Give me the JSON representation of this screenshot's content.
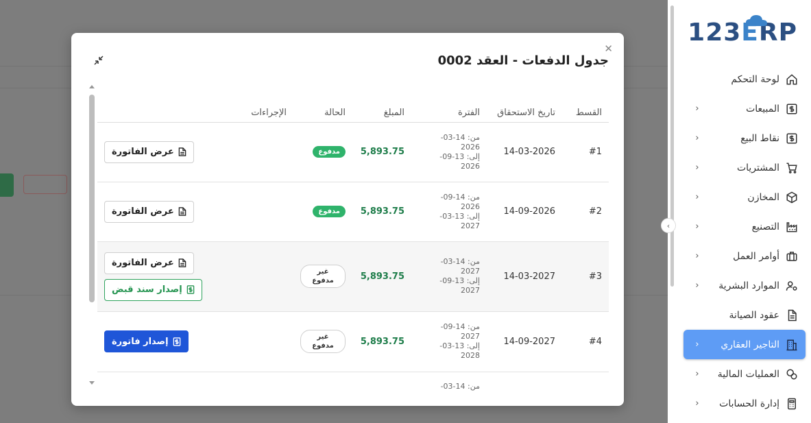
{
  "sidebar": {
    "logo": "123ERP",
    "items": [
      {
        "label": "لوحة التحكم",
        "icon": "home-icon",
        "has_children": false,
        "active": false
      },
      {
        "label": "المبيعات",
        "icon": "dollar-icon",
        "has_children": true,
        "active": false
      },
      {
        "label": "نقاط البيع",
        "icon": "dollar-icon",
        "has_children": true,
        "active": false
      },
      {
        "label": "المشتريات",
        "icon": "cart-icon",
        "has_children": true,
        "active": false
      },
      {
        "label": "المخازن",
        "icon": "box-icon",
        "has_children": true,
        "active": false
      },
      {
        "label": "التصنيع",
        "icon": "factory-icon",
        "has_children": true,
        "active": false
      },
      {
        "label": "أوامر العمل",
        "icon": "briefcase-icon",
        "has_children": true,
        "active": false
      },
      {
        "label": "الموارد البشرية",
        "icon": "user-gear-icon",
        "has_children": true,
        "active": false
      },
      {
        "label": "عقود الصيانة",
        "icon": "document-icon",
        "has_children": false,
        "active": false
      },
      {
        "label": "التاجير العقاري",
        "icon": "building-icon",
        "has_children": true,
        "active": true
      },
      {
        "label": "العمليات المالية",
        "icon": "coins-icon",
        "has_children": true,
        "active": false
      },
      {
        "label": "إدارة الحسابات",
        "icon": "calculator-icon",
        "has_children": true,
        "active": false
      }
    ]
  },
  "modal": {
    "title": "جدول الدفعات - العقد 0002",
    "columns": {
      "installment": "القسط",
      "due_date": "تاريخ الاستحقاق",
      "period": "الفترة",
      "amount": "المبلغ",
      "status": "الحالة",
      "actions": "الإجراءات"
    },
    "rows": [
      {
        "installment": "#1",
        "due_date": "14-03-2026",
        "period_from": "من: 14-03-2026",
        "period_to": "إلى: 13-09-2026",
        "amount": "5,893.75",
        "status": "مدفوع",
        "view_invoice": "عرض الفاتورة"
      },
      {
        "installment": "#2",
        "due_date": "14-09-2026",
        "period_from": "من: 14-09-2026",
        "period_to": "إلى: 13-03-2027",
        "amount": "5,893.75",
        "status": "مدفوع",
        "view_invoice": "عرض الفاتورة"
      },
      {
        "installment": "#3",
        "due_date": "14-03-2027",
        "period_from": "من: 14-03-2027",
        "period_to": "إلى: 13-09-2027",
        "amount": "5,893.75",
        "status": "غير مدفوع",
        "view_invoice": "عرض الفاتورة",
        "issue_receipt": "إصدار سند قبض"
      },
      {
        "installment": "#4",
        "due_date": "14-09-2027",
        "period_from": "من: 14-09-2027",
        "period_to": "إلى: 13-03-2028",
        "amount": "5,893.75",
        "status": "غير مدفوع",
        "issue_invoice": "إصدار فاتورة"
      },
      {
        "installment": "",
        "due_date": "",
        "period_from": "من: 14-03-",
        "period_to": "",
        "amount": "",
        "status": ""
      }
    ]
  },
  "colors": {
    "primary": "#1f56d8",
    "sidebar_active": "#5e9cf5",
    "paid": "#2fb36b",
    "amount": "#1e7d4a",
    "receipt": "#2ea35c"
  }
}
